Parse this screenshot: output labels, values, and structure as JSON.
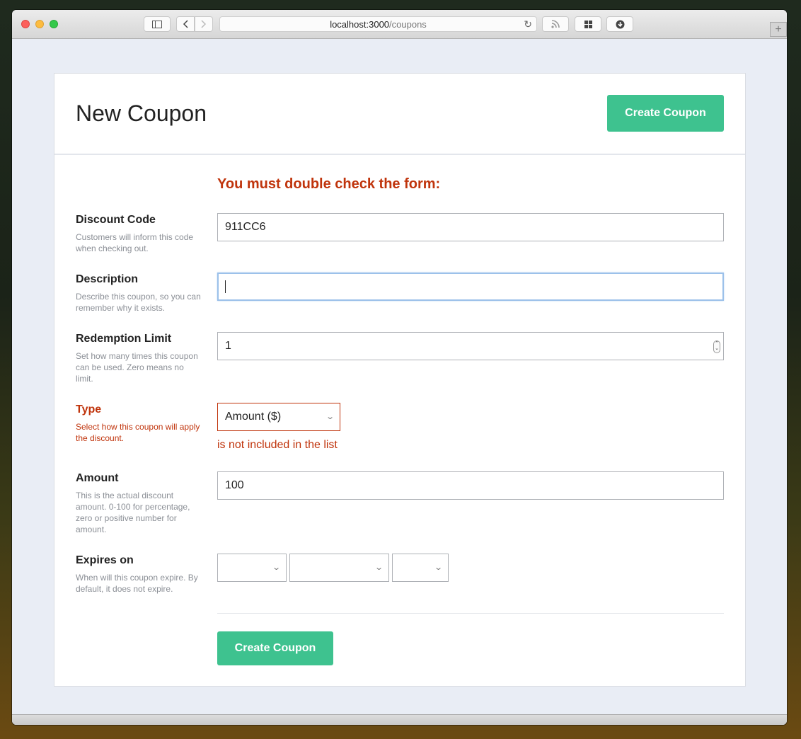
{
  "browser": {
    "url_host": "localhost:3000",
    "url_path": "/coupons",
    "icons": [
      "sidebar-icon",
      "back-icon",
      "forward-icon",
      "reload-icon",
      "rss-icon",
      "grid-icon",
      "download-icon",
      "new-tab-icon"
    ]
  },
  "header": {
    "title": "New Coupon",
    "create_button": "Create Coupon"
  },
  "form": {
    "error_title": "You must double check the form:",
    "discount_code": {
      "label": "Discount Code",
      "help": "Customers will inform this code when checking out.",
      "value": "911CC6"
    },
    "description": {
      "label": "Description",
      "help": "Describe this coupon, so you can remember why it exists.",
      "value": ""
    },
    "redemption_limit": {
      "label": "Redemption Limit",
      "help": "Set how many times this coupon can be used. Zero means no limit.",
      "value": "1"
    },
    "type": {
      "label": "Type",
      "help": "Select how this coupon will apply the discount.",
      "selected": "Amount ($)",
      "error": "is not included in the list"
    },
    "amount": {
      "label": "Amount",
      "help": "This is the actual discount amount. 0-100 for percentage, zero or positive number for amount.",
      "value": "100"
    },
    "expires_on": {
      "label": "Expires on",
      "help": "When will this coupon expire. By default, it does not expire.",
      "year": "",
      "month": "",
      "day": ""
    },
    "submit_label": "Create Coupon"
  },
  "colors": {
    "accent_green": "#3ec28f",
    "error_red": "#c0340c",
    "page_background": "#e9edf5"
  }
}
